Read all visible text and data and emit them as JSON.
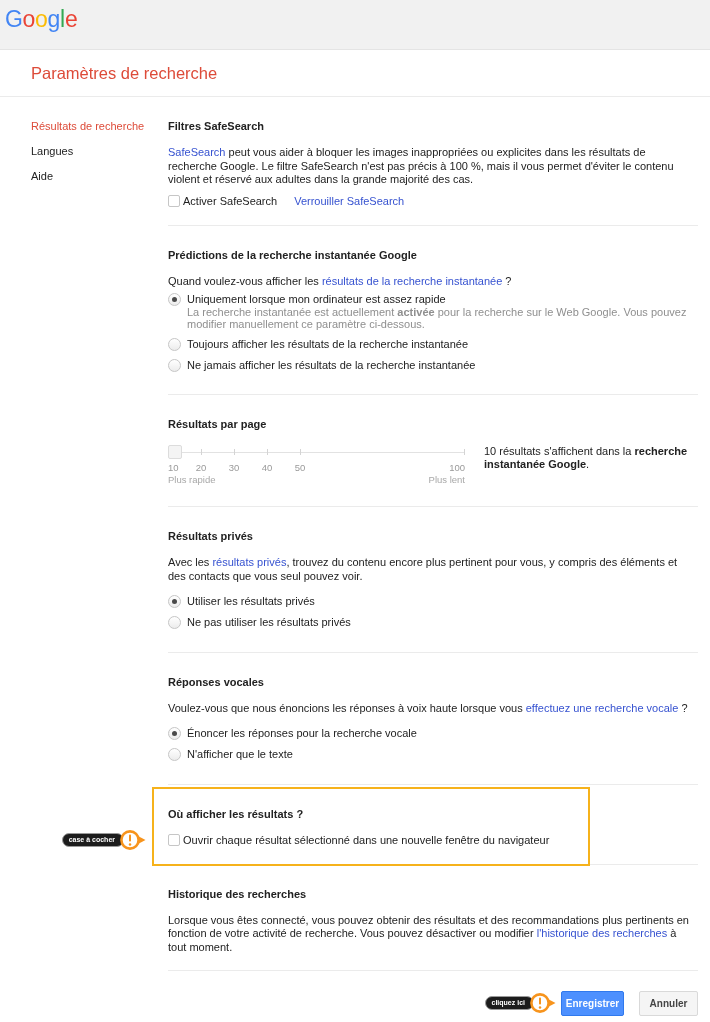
{
  "header": {
    "logo": "Google"
  },
  "page_title": "Paramètres de recherche",
  "sidebar": {
    "items": [
      {
        "label": "Résultats de recherche",
        "selected": true
      },
      {
        "label": "Langues",
        "selected": false
      },
      {
        "label": "Aide",
        "selected": false
      }
    ]
  },
  "sections": [
    {
      "kind": "safesearch",
      "title": "Filtres SafeSearch",
      "description": [
        {
          "kind": "link",
          "text": "SafeSearch"
        },
        {
          "kind": "text",
          "text": " peut vous aider à bloquer les images inappropriées ou explicites dans les résultats de recherche Google. Le filtre SafeSearch n'est pas précis à 100 %, mais il vous permet d'éviter le contenu violent et réservé aux adultes dans la grande majorité des cas."
        }
      ],
      "checkbox": {
        "label": "Activer SafeSearch",
        "checked": false
      },
      "link": "Verrouiller SafeSearch"
    },
    {
      "kind": "options",
      "title": "Prédictions de la recherche instantanée Google",
      "description": [
        {
          "kind": "text",
          "text": "Quand voulez-vous afficher les "
        },
        {
          "kind": "link",
          "text": "résultats de la recherche instantanée"
        },
        {
          "kind": "text",
          "text": " ?"
        }
      ],
      "options": [
        {
          "label": "Uniquement lorsque mon ordinateur est assez rapide",
          "selected": true,
          "note": "La recherche instantanée est actuellement **activée** pour la recherche sur le Web Google. Vous pouvez modifier manuellement ce paramètre ci-dessous."
        },
        {
          "label": "Toujours afficher les résultats de la recherche instantanée",
          "selected": false
        },
        {
          "label": "Ne jamais afficher les résultats de la recherche instantanée",
          "selected": false
        }
      ]
    },
    {
      "kind": "slider",
      "title": "Résultats par page",
      "slider": {
        "level": 0,
        "ticks": [
          "10",
          "20",
          "30",
          "40",
          "50",
          "100"
        ],
        "min_label": "Plus rapide",
        "max_label": "Plus lent"
      },
      "summary": "10 résultats s'affichent dans la **recherche instantanée Google**."
    },
    {
      "kind": "options",
      "title": "Résultats privés",
      "description": [
        {
          "kind": "text",
          "text": "Avec les "
        },
        {
          "kind": "link",
          "text": "résultats privés"
        },
        {
          "kind": "text",
          "text": ", trouvez du contenu encore plus pertinent pour vous, y compris des éléments et des contacts que vous seul pouvez voir."
        }
      ],
      "options": [
        {
          "label": "Utiliser les résultats privés",
          "selected": true
        },
        {
          "label": "Ne pas utiliser les résultats privés",
          "selected": false
        }
      ]
    },
    {
      "kind": "options",
      "title": "Réponses vocales",
      "description": [
        {
          "kind": "text",
          "text": "Voulez-vous que nous énoncions les réponses à voix haute lorsque vous "
        },
        {
          "kind": "link",
          "text": "effectuez une recherche vocale"
        },
        {
          "kind": "text",
          "text": " ?"
        }
      ],
      "options": [
        {
          "label": "Énoncer les réponses pour la recherche vocale",
          "selected": true
        },
        {
          "label": "N'afficher que le texte",
          "selected": false
        }
      ]
    },
    {
      "kind": "checkbox",
      "title": "Où afficher les résultats ?",
      "highlighted": true,
      "callout": "case à cocher",
      "checkbox": {
        "label": "Ouvrir chaque résultat sélectionné dans une nouvelle fenêtre du navigateur",
        "checked": false
      }
    },
    {
      "kind": "text",
      "title": "Historique des recherches",
      "description": [
        {
          "kind": "text",
          "text": "Lorsque vous êtes connecté, vous pouvez obtenir des résultats et des recommandations plus pertinents en fonction de votre activité de recherche. Vous pouvez désactiver ou modifier "
        },
        {
          "kind": "link",
          "text": "l'historique des recherches"
        },
        {
          "kind": "text",
          "text": " à tout moment."
        }
      ]
    }
  ],
  "footer": {
    "callout": "cliquez ici",
    "buttons": [
      {
        "label": "Enregistrer",
        "kind": "primary"
      },
      {
        "label": "Annuler",
        "kind": "secondary"
      }
    ]
  }
}
